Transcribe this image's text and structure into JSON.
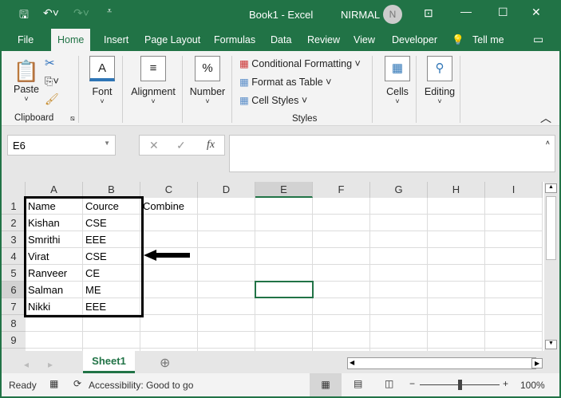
{
  "title_bar": {
    "doc_title": "Book1  -  Excel",
    "user": "NIRMAL",
    "avatar_initial": "N"
  },
  "menu_tabs": [
    "File",
    "Home",
    "Insert",
    "Page Layout",
    "Formulas",
    "Data",
    "Review",
    "View",
    "Developer"
  ],
  "tell_me": "Tell me",
  "ribbon": {
    "clipboard": {
      "paste": "Paste",
      "group": "Clipboard"
    },
    "font": "Font",
    "alignment": "Alignment",
    "number": "Number",
    "styles": {
      "conditional": "Conditional Formatting",
      "format_table": "Format as Table",
      "cell_styles": "Cell Styles",
      "group": "Styles"
    },
    "cells": "Cells",
    "editing": "Editing"
  },
  "formula_bar": {
    "name_box": "E6",
    "fx": "fx",
    "value": ""
  },
  "columns": [
    "A",
    "B",
    "C",
    "D",
    "E",
    "F",
    "G",
    "H",
    "I"
  ],
  "rows": [
    "1",
    "2",
    "3",
    "4",
    "5",
    "6",
    "7",
    "8",
    "9"
  ],
  "cells": [
    [
      "Name",
      "Cource",
      "Combine"
    ],
    [
      "Kishan",
      "CSE"
    ],
    [
      "Smrithi",
      "EEE"
    ],
    [
      "Virat",
      "CSE"
    ],
    [
      "Ranveer",
      "CE"
    ],
    [
      "Salman",
      "ME"
    ],
    [
      "Nikki",
      "EEE"
    ]
  ],
  "selected_cell": "E6",
  "sheet_tab": "Sheet1",
  "status": {
    "ready": "Ready",
    "accessibility": "Accessibility: Good to go",
    "zoom": "100%"
  },
  "colors": {
    "accent": "#217346"
  }
}
